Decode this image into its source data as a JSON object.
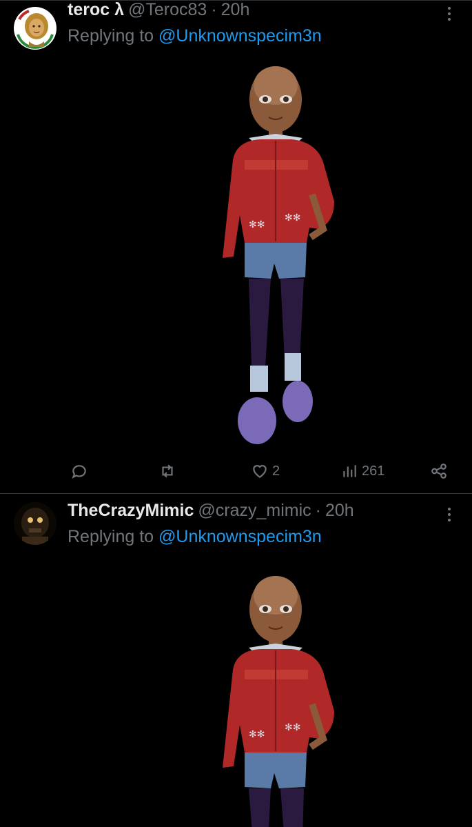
{
  "tweets": [
    {
      "display_name": "teroc λ",
      "handle": "@Teroc83",
      "separator": "·",
      "time": "20h",
      "reply_prefix": "Replying to",
      "reply_mention": "@Unknownspecim3n",
      "likes": "2",
      "views": "261",
      "avatar_icon": "avatar-illustrated-person"
    },
    {
      "display_name": "TheCrazyMimic",
      "handle": "@crazy_mimic",
      "separator": "·",
      "time": "20h",
      "reply_prefix": "Replying to",
      "reply_mention": "@Unknownspecim3n",
      "avatar_icon": "avatar-dark-robot"
    }
  ],
  "colors": {
    "background": "#000000",
    "text_primary": "#e7e9ea",
    "text_secondary": "#71767b",
    "link": "#1d9bf0",
    "divider": "#2f3336"
  },
  "icons": [
    "reply-icon",
    "retweet-icon",
    "like-icon",
    "views-icon",
    "share-icon",
    "more-icon"
  ]
}
